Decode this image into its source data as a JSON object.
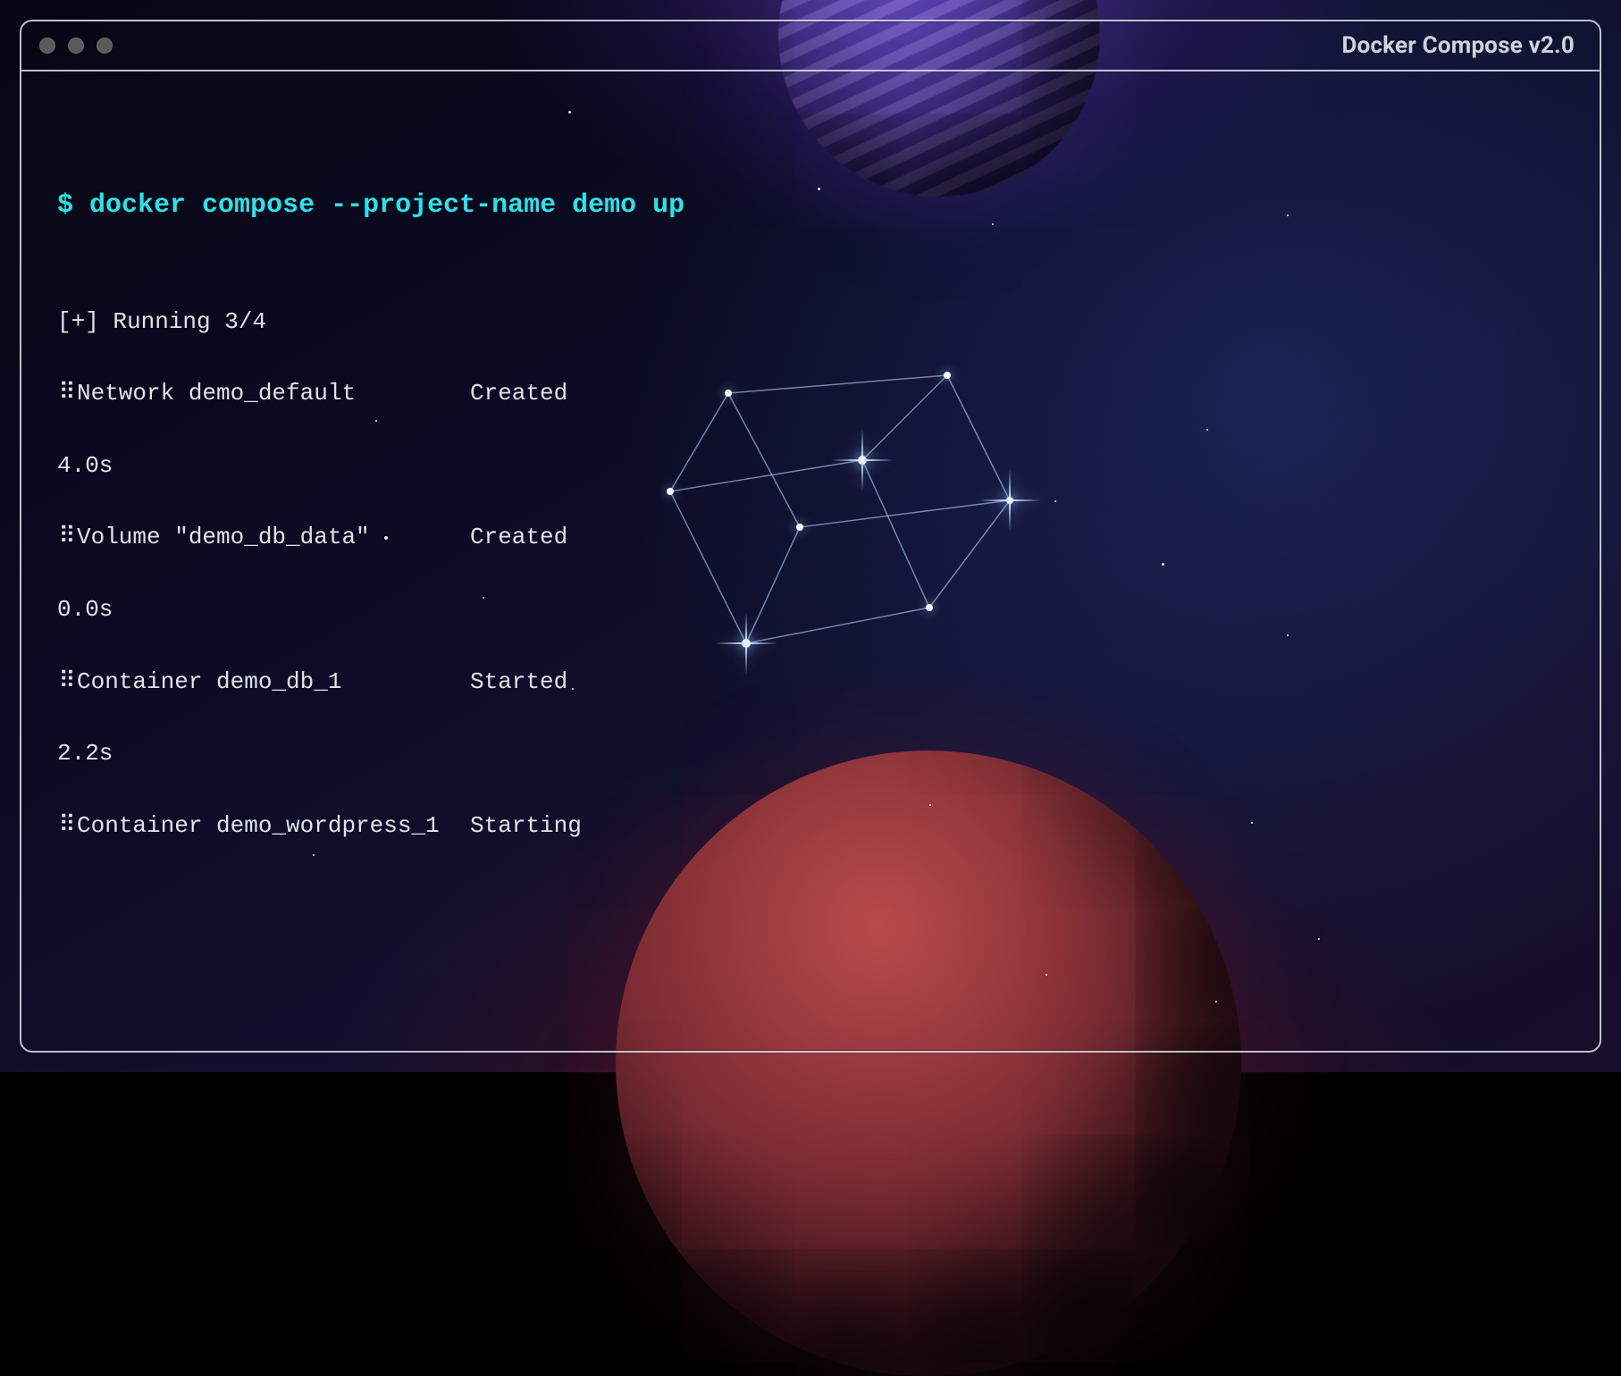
{
  "window": {
    "title": "Docker Compose v2.0"
  },
  "terminal": {
    "prompt": "$",
    "command": "docker compose --project-name demo up",
    "status": "[+] Running 3/4",
    "rows": [
      {
        "spinner": "⠿",
        "label": "Network demo_default",
        "state": "Created",
        "time": "4.0s"
      },
      {
        "spinner": "⠿",
        "label": "Volume \"demo_db_data\"",
        "state": "Created",
        "time": "0.0s"
      },
      {
        "spinner": "⠿",
        "label": "Container demo_db_1",
        "state": "Started",
        "time": "2.2s"
      },
      {
        "spinner": "⠿",
        "label": "Container demo_wordpress_1",
        "state": "Starting",
        "time": ""
      }
    ]
  }
}
